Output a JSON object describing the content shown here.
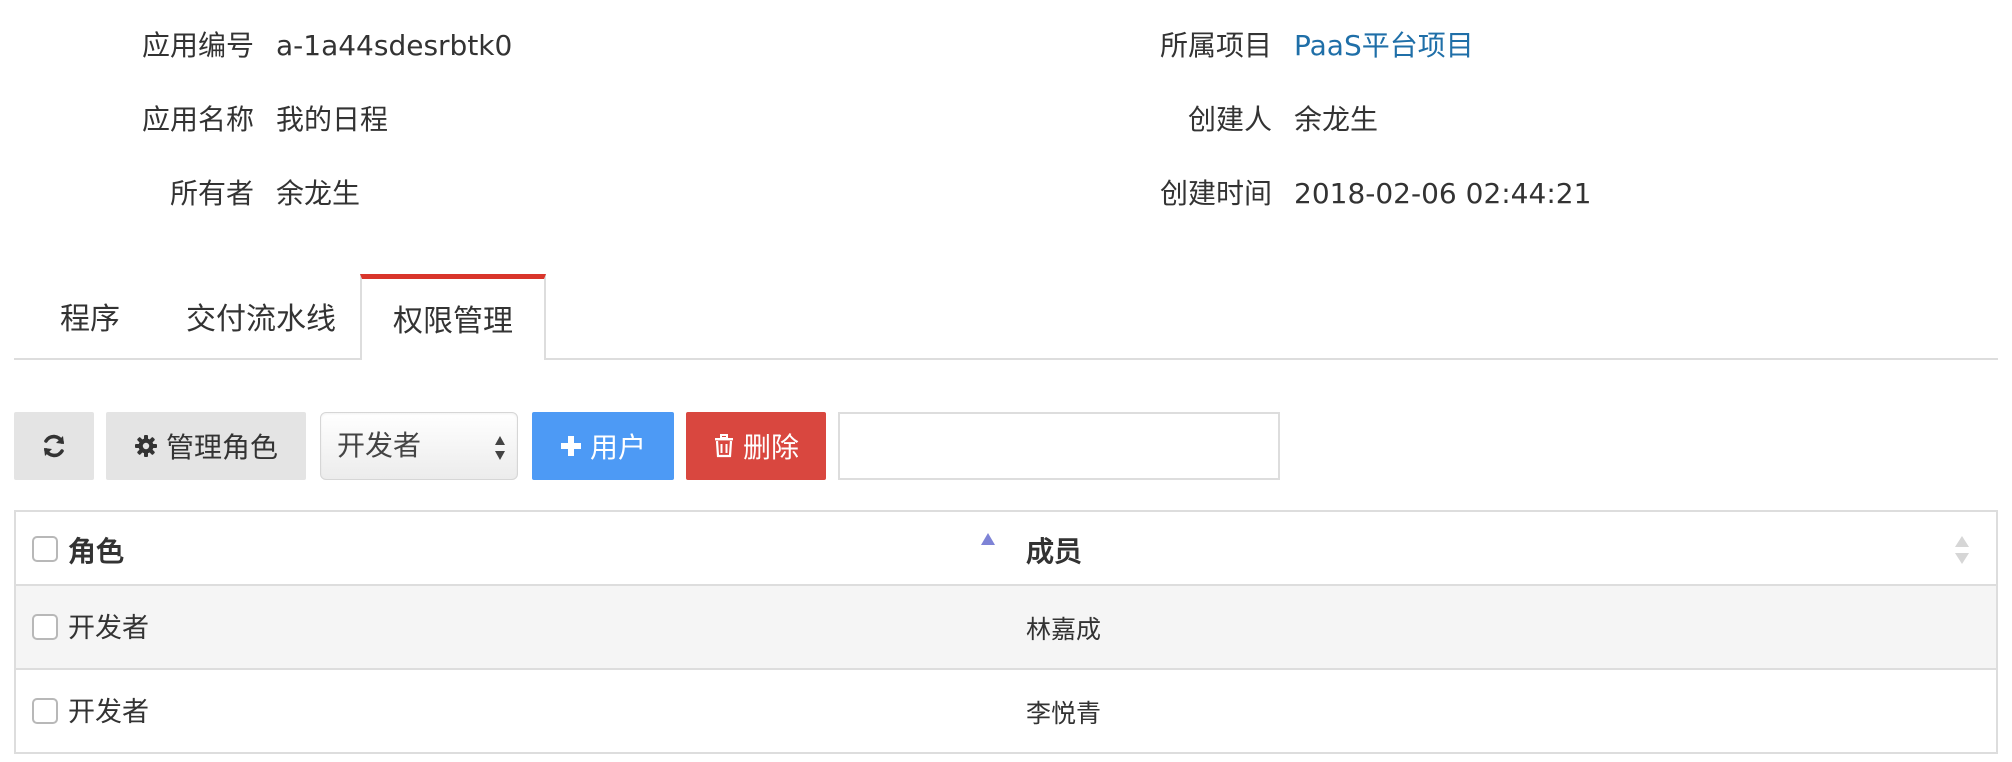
{
  "info": {
    "app_id_label": "应用编号",
    "app_id_value": "a-1a44sdesrbtk0",
    "project_label": "所属项目",
    "project_value": "PaaS平台项目",
    "app_name_label": "应用名称",
    "app_name_value": "我的日程",
    "creator_label": "创建人",
    "creator_value": "余龙生",
    "owner_label": "所有者",
    "owner_value": "余龙生",
    "created_at_label": "创建时间",
    "created_at_value": "2018-02-06 02:44:21"
  },
  "tabs": [
    {
      "label": "程序"
    },
    {
      "label": "交付流水线"
    },
    {
      "label": "权限管理"
    }
  ],
  "toolbar": {
    "refresh_icon": "refresh-icon",
    "manage_roles_label": "管理角色",
    "role_select_value": "开发者",
    "add_user_label": "用户",
    "delete_label": "删除",
    "search_value": ""
  },
  "table": {
    "columns": [
      "角色",
      "成员"
    ],
    "rows": [
      {
        "role": "开发者",
        "member": "林嘉成"
      },
      {
        "role": "开发者",
        "member": "李悦青"
      }
    ]
  },
  "colors": {
    "active_tab_accent": "#d9352b",
    "primary": "#4d9af5",
    "danger": "#d9473f",
    "link": "#1f6fa8"
  }
}
